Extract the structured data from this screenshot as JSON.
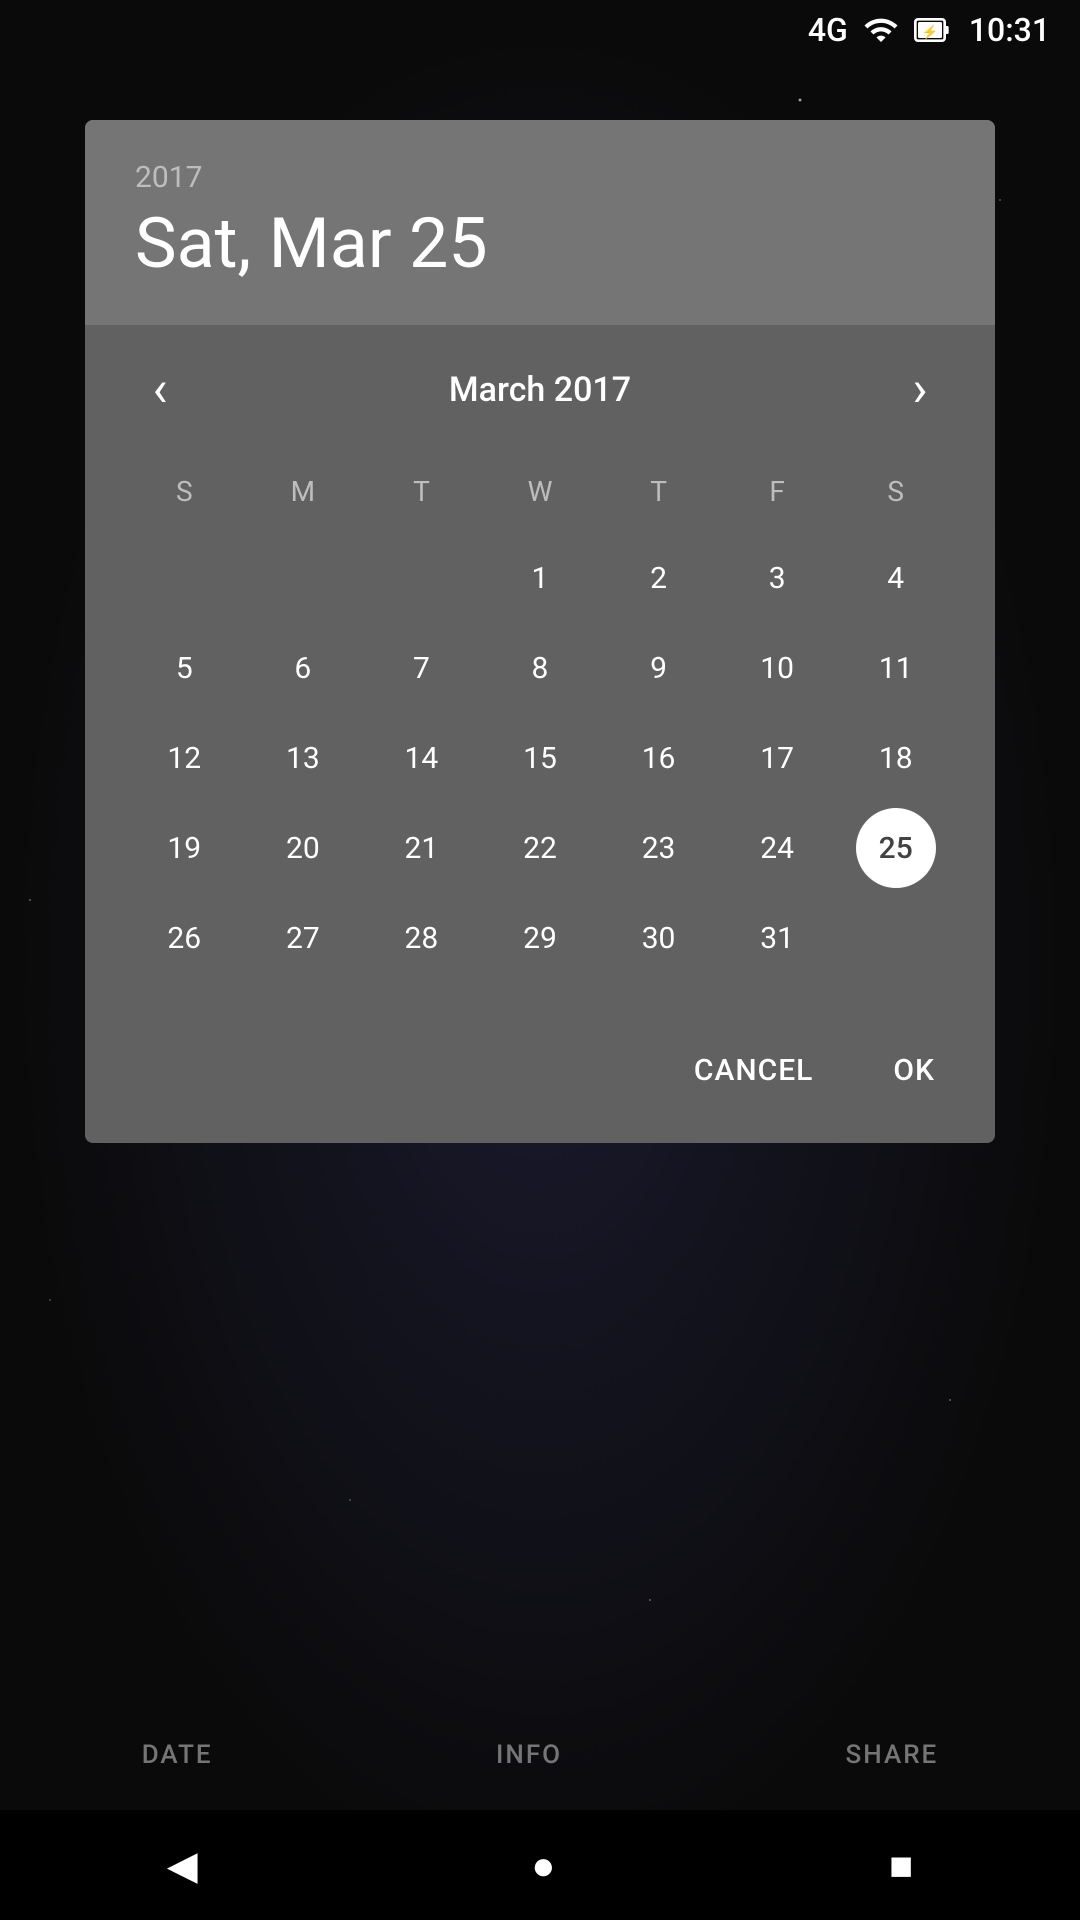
{
  "statusBar": {
    "networkType": "4G",
    "time": "10:31"
  },
  "dialog": {
    "year": "2017",
    "selectedDate": "Sat, Mar 25",
    "monthTitle": "March 2017",
    "prevLabel": "‹",
    "nextLabel": "›",
    "dayHeaders": [
      "S",
      "M",
      "T",
      "W",
      "T",
      "F",
      "S"
    ],
    "weeks": [
      [
        "",
        "",
        "",
        "1",
        "2",
        "3",
        "4"
      ],
      [
        "5",
        "6",
        "7",
        "8",
        "9",
        "10",
        "11"
      ],
      [
        "12",
        "13",
        "14",
        "15",
        "16",
        "17",
        "18"
      ],
      [
        "19",
        "20",
        "21",
        "22",
        "23",
        "24",
        "25"
      ],
      [
        "26",
        "27",
        "28",
        "29",
        "30",
        "31",
        ""
      ]
    ],
    "selectedDay": "25",
    "cancelLabel": "CANCEL",
    "okLabel": "OK"
  },
  "bottomTabs": {
    "date": "DATE",
    "info": "INFO",
    "share": "SHARE"
  },
  "navBar": {
    "backIcon": "◀",
    "homeIcon": "●",
    "recentIcon": "■"
  }
}
